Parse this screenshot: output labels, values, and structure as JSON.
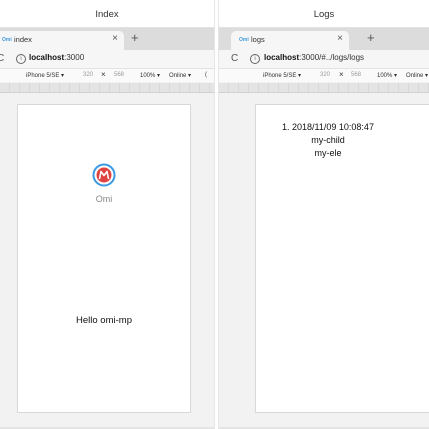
{
  "index_panel": {
    "title": "Index",
    "tab": {
      "favicon": "Omi",
      "label": "index",
      "close": "×"
    },
    "new_tab": "+",
    "address": {
      "reload": "C",
      "info": "i",
      "host": "localhost",
      "rest": ":3000"
    },
    "devtools": {
      "device": "iPhone 5/SE ▾",
      "width": "320",
      "times": "×",
      "height": "568",
      "zoom": "100% ▾",
      "network": "Online ▾",
      "extra": "("
    },
    "app": {
      "logo_label": "Omi",
      "hello": "Hello omi-mp"
    }
  },
  "logs_panel": {
    "title": "Logs",
    "tab": {
      "favicon": "Omi",
      "label": "logs",
      "close": "×"
    },
    "new_tab": "+",
    "address": {
      "reload": "C",
      "info": "i",
      "host": "localhost",
      "rest": ":3000/#../logs/logs"
    },
    "devtools": {
      "device": "iPhone 5/SE ▾",
      "width": "320",
      "times": "×",
      "height": "568",
      "zoom": "100% ▾",
      "network": "Online ▾"
    },
    "app": {
      "log_line": "1. 2018/11/09 10:08:47",
      "child_1": "my-child",
      "child_2": "my-ele"
    }
  },
  "icons": {
    "logo": "omi-logo-icon",
    "reload": "reload-icon",
    "info": "info-icon",
    "close": "close-icon",
    "new_tab": "plus-icon"
  },
  "colors": {
    "logo_blue": "#3b9ae1",
    "logo_red": "#e0433f"
  }
}
